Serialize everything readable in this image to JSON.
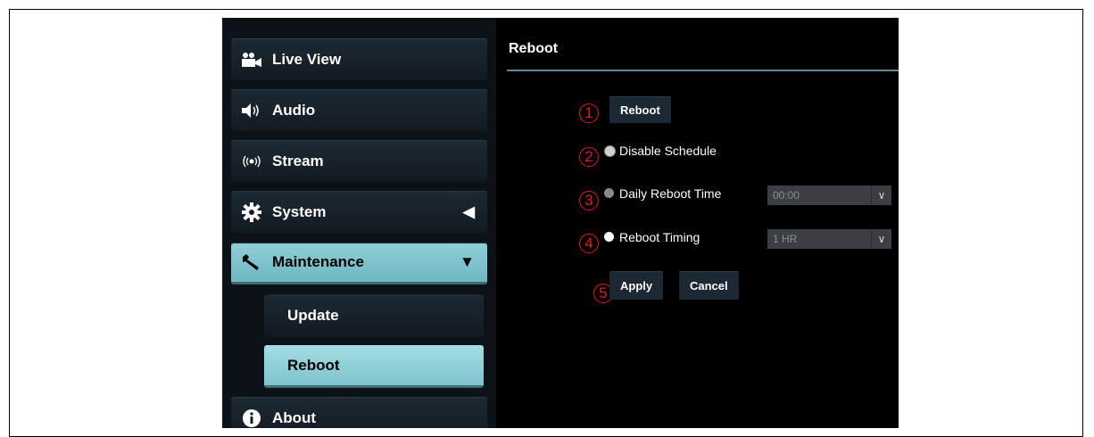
{
  "sidebar": {
    "items": [
      {
        "label": "Live View",
        "icon": "video-camera-icon"
      },
      {
        "label": "Audio",
        "icon": "speaker-icon"
      },
      {
        "label": "Stream",
        "icon": "broadcast-icon"
      },
      {
        "label": "System",
        "icon": "gear-icon",
        "caret": "◀"
      },
      {
        "label": "Maintenance",
        "icon": "wrench-icon",
        "caret": "▼"
      },
      {
        "label": "About",
        "icon": "info-icon"
      }
    ],
    "sub_items": [
      {
        "label": "Update"
      },
      {
        "label": "Reboot"
      }
    ]
  },
  "main": {
    "title": "Reboot",
    "reboot_button": "Reboot",
    "options": [
      {
        "label": "Disable Schedule",
        "marker": "2"
      },
      {
        "label": "Daily Reboot Time",
        "marker": "3",
        "value": "00:00"
      },
      {
        "label": "Reboot Timing",
        "marker": "4",
        "value": "1 HR"
      }
    ],
    "markers": {
      "reboot": "1",
      "apply": "5"
    },
    "apply_button": "Apply",
    "cancel_button": "Cancel",
    "select_arrow": "∨"
  },
  "colors": {
    "accent": "#7ec3cc",
    "marker": "#e21b1b",
    "background": "#000000"
  }
}
